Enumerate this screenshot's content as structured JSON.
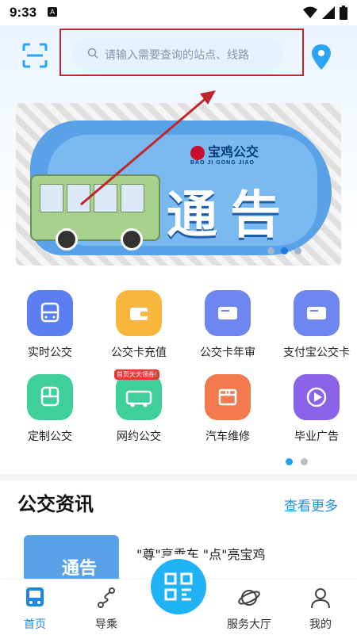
{
  "status": {
    "time": "9:33",
    "a_badge": "A"
  },
  "search": {
    "placeholder": "请输入需要查询的站点、线路"
  },
  "banner": {
    "brand_name": "宝鸡公交",
    "brand_sub": "BAO JI GONG JIAO",
    "headline": "通告",
    "page_count": 3,
    "active_page": 1
  },
  "services": [
    {
      "label": "实时公交",
      "icon": "bus-icon",
      "color": "#5b7ff0"
    },
    {
      "label": "公交卡充值",
      "icon": "wallet-icon",
      "color": "#f6b73c"
    },
    {
      "label": "公交卡年审",
      "icon": "card-icon",
      "color": "#6f86f0"
    },
    {
      "label": "支付宝公交卡",
      "icon": "card-icon",
      "color": "#6f86f0"
    },
    {
      "label": "定制公交",
      "icon": "bus-icon",
      "color": "#3fcf9a"
    },
    {
      "label": "网约公交",
      "icon": "bus-side-icon",
      "color": "#3fcf9a",
      "tag": "首页天天领券!"
    },
    {
      "label": "汽车维修",
      "icon": "repair-icon",
      "color": "#f37a4e"
    },
    {
      "label": "毕业广告",
      "icon": "graduation-icon",
      "color": "#8a63e8"
    }
  ],
  "grid_pager": {
    "pages": 2,
    "active": 0
  },
  "news": {
    "title": "公交资讯",
    "more": "查看更多",
    "items": [
      {
        "title": "\"尊\"享乘车 \"点\"亮宝鸡",
        "thumb_text": "通告"
      }
    ]
  },
  "tabbar": {
    "tabs": [
      {
        "label": "首页",
        "icon": "bus-front-icon",
        "active": true
      },
      {
        "label": "导乘",
        "icon": "route-icon",
        "active": false
      },
      {
        "label": "服务大厅",
        "icon": "planet-icon",
        "active": false
      },
      {
        "label": "我的",
        "icon": "user-icon",
        "active": false
      }
    ],
    "center": {
      "icon": "qr-scan-icon"
    }
  },
  "colors": {
    "accent": "#1e88e5",
    "annotation": "#c0262a"
  }
}
